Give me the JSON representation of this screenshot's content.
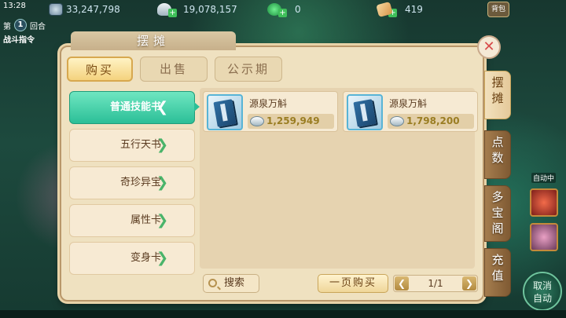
{
  "status": {
    "clock": "13:28",
    "coin_icon": "coin-icon",
    "coins": "33,247,798",
    "silver": "19,078,157",
    "jade": "0",
    "tickets": "419",
    "corner_label": "背包"
  },
  "battle": {
    "round_prefix": "第",
    "round_number": "1",
    "round_suffix": "回合",
    "command_label": "战斗指令"
  },
  "panel": {
    "title": "摆摊",
    "close_symbol": "✕"
  },
  "tabs": [
    {
      "label": "购买",
      "active": true
    },
    {
      "label": "出售",
      "active": false
    },
    {
      "label": "公示期",
      "active": false
    }
  ],
  "categories": [
    {
      "label": "普通技能书",
      "active": true,
      "chevron": "❮"
    },
    {
      "label": "五行天书",
      "active": false,
      "chevron": "❯"
    },
    {
      "label": "奇珍异宝",
      "active": false,
      "chevron": "❯"
    },
    {
      "label": "属性卡",
      "active": false,
      "chevron": "❯"
    },
    {
      "label": "变身卡",
      "active": false,
      "chevron": "❯"
    }
  ],
  "items": [
    {
      "name": "源泉万斛",
      "price": "1,259,949",
      "icon": "skill-book-icon"
    },
    {
      "name": "源泉万斛",
      "price": "1,798,200",
      "icon": "skill-book-icon"
    }
  ],
  "bottom": {
    "search_label": "搜索",
    "buy_page_label": "一页购买",
    "page_indicator": "1/1",
    "prev_symbol": "❮",
    "next_symbol": "❯"
  },
  "side_tabs": [
    {
      "label": "摆\n摊",
      "active": true
    },
    {
      "label": "点\n数",
      "active": false
    },
    {
      "label": "多\n宝\n阁",
      "active": false
    },
    {
      "label": "充\n值",
      "active": false
    }
  ],
  "auto": {
    "label": "自动中",
    "cancel_line1": "取消",
    "cancel_line2": "自动"
  },
  "colors": {
    "active_category": "#2bbf97",
    "price_text": "#9a7d22",
    "close_x": "#d84b4b"
  }
}
